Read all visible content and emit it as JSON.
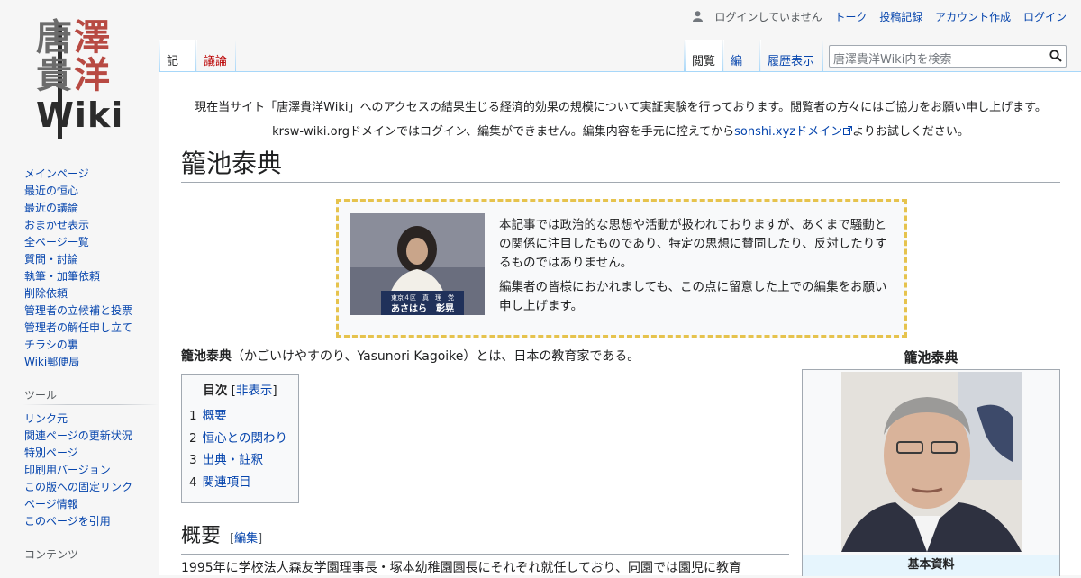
{
  "logo": {
    "line1": "唐澤",
    "line2": "貴洋",
    "line3": "Wiki"
  },
  "personal": {
    "status": "ログインしていません",
    "links": [
      "トーク",
      "投稿記録",
      "アカウント作成",
      "ログイン"
    ]
  },
  "tabs": {
    "left": [
      "記事",
      "議論"
    ],
    "right": [
      "閲覧",
      "編集",
      "履歴表示"
    ]
  },
  "search": {
    "placeholder": "唐澤貴洋Wiki内を検索"
  },
  "sidebar": {
    "navigation": [
      "メインページ",
      "最近の恒心",
      "最近の議論",
      "おまかせ表示",
      "全ページ一覧",
      "質問・討論",
      "執筆・加筆依頼",
      "削除依頼",
      "管理者の立候補と投票",
      "管理者の解任申し立て",
      "チラシの裏",
      "Wiki郵便局"
    ],
    "tools_heading": "ツール",
    "tools": [
      "リンク元",
      "関連ページの更新状況",
      "特別ページ",
      "印刷用バージョン",
      "この版への固定リンク",
      "ページ情報",
      "このページを引用"
    ],
    "contents_heading": "コンテンツ"
  },
  "sitenotice": {
    "line1": "現在当サイト「唐澤貴洋Wiki」へのアクセスの結果生じる経済的効果の規模について実証実験を行っております。閲覧者の方々にはご協力をお願い申し上げます。",
    "line2_pre": "krsw-wiki.orgドメインではログイン、編集ができません。編集内容を手元に控えてから",
    "line2_link": "sonshi.xyzドメイン",
    "line2_post": "よりお試しください。"
  },
  "page": {
    "title": "籠池泰典",
    "notice": {
      "p1": "本記事では政治的な思想や活動が扱われておりますが、あくまで騒動との関係に注目したものであり、特定の思想に賛同したり、反対したりするものではありません。",
      "p2": "編集者の皆様におかれましても、この点に留意した上での編集をお願い申し上げます。",
      "image_caption_top": "東京４区　真　理　党",
      "image_caption": "あさはら　彰晃"
    },
    "lead_bold": "籠池泰典",
    "lead_rest": "（かごいけやすのり、Yasunori Kagoike）とは、日本の教育家である。",
    "toc": {
      "title": "目次",
      "toggle": "非表示",
      "items": [
        {
          "num": "1",
          "label": "概要"
        },
        {
          "num": "2",
          "label": "恒心との関わり"
        },
        {
          "num": "3",
          "label": "出典・註釈"
        },
        {
          "num": "4",
          "label": "関連項目"
        }
      ]
    },
    "section1": {
      "heading": "概要",
      "edit": "編集",
      "text": "1995年に学校法人森友学園理事長・塚本幼稚園園長にそれぞれ就任しており、同園では園児に教育"
    }
  },
  "infobox": {
    "title": "籠池泰典",
    "section": "基本資料"
  },
  "colors": {
    "link": "#0645ad",
    "notice_border": "#e6c34d",
    "tab_border": "#a7d7f9"
  }
}
